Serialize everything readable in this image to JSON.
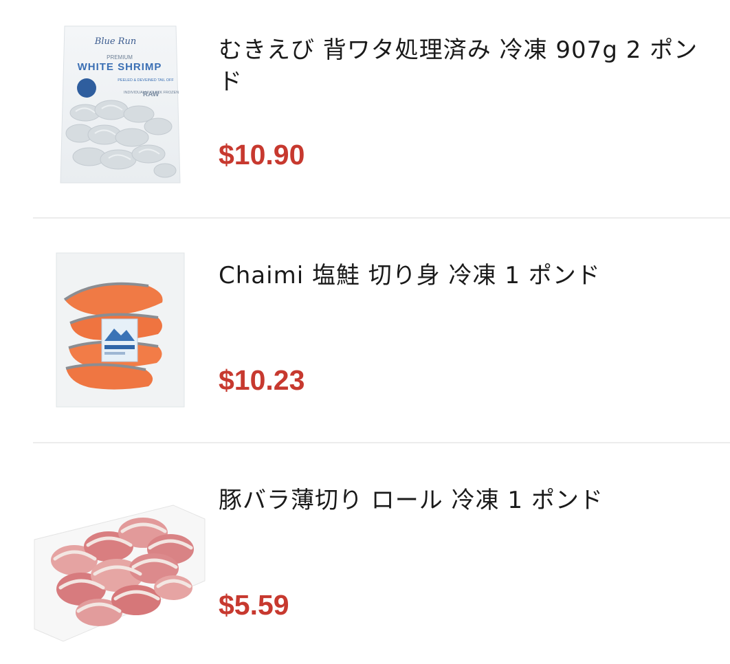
{
  "products": [
    {
      "title": "むきえび 背ワタ処理済み 冷凍 907g 2 ポンド",
      "price": "$10.90",
      "image": {
        "kind": "shrimp-bag-image",
        "brand": "Blue Run",
        "premium": "PREMIUM",
        "name": "WHITE SHRIMP",
        "sub": "PEELED & DEVEINED TAIL OFF",
        "note": "INDIVIDUALLY QUICK FROZEN",
        "raw": "RAW"
      }
    },
    {
      "title": "Chaimi 塩鮭 切り身 冷凍 1 ポンド",
      "price": "$10.23",
      "image": {
        "kind": "salmon-pack-image"
      }
    },
    {
      "title": "豚バラ薄切り ロール 冷凍 1 ポンド",
      "price": "$5.59",
      "image": {
        "kind": "pork-belly-tray-image"
      }
    }
  ],
  "colors": {
    "price": "#c7392f",
    "divider": "#ececec",
    "text": "#1a1a1a"
  }
}
